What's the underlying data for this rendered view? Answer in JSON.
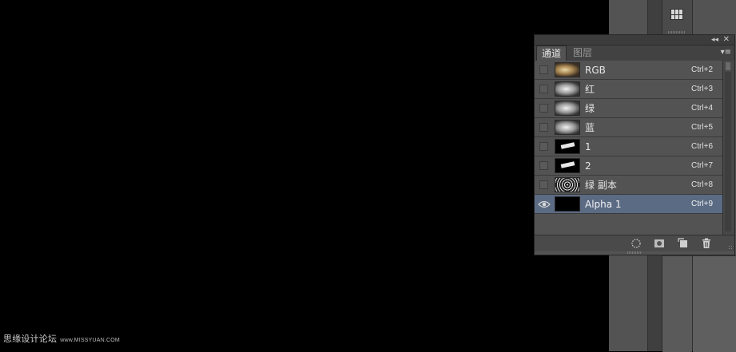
{
  "watermark": {
    "text": "思缘设计论坛",
    "url": "www.MISSYUAN.COM"
  },
  "panel": {
    "tabs": [
      {
        "label": "通道",
        "active": true
      },
      {
        "label": "图层",
        "active": false
      }
    ],
    "channels": [
      {
        "name": "RGB",
        "shortcut": "Ctrl+2",
        "thumb": "rgb",
        "visible": false,
        "selected": false
      },
      {
        "name": "红",
        "shortcut": "Ctrl+3",
        "thumb": "gray",
        "visible": false,
        "selected": false
      },
      {
        "name": "绿",
        "shortcut": "Ctrl+4",
        "thumb": "gray",
        "visible": false,
        "selected": false
      },
      {
        "name": "蓝",
        "shortcut": "Ctrl+5",
        "thumb": "gray",
        "visible": false,
        "selected": false
      },
      {
        "name": "1",
        "shortcut": "Ctrl+6",
        "thumb": "mask",
        "visible": false,
        "selected": false
      },
      {
        "name": "2",
        "shortcut": "Ctrl+7",
        "thumb": "mask",
        "visible": false,
        "selected": false
      },
      {
        "name": "绿 副本",
        "shortcut": "Ctrl+8",
        "thumb": "noise",
        "visible": false,
        "selected": false
      },
      {
        "name": "Alpha 1",
        "shortcut": "Ctrl+9",
        "thumb": "black",
        "visible": true,
        "selected": true
      }
    ],
    "footer_icons": [
      "load-selection-icon",
      "save-selection-icon",
      "new-channel-icon",
      "trash-icon"
    ]
  },
  "colors": {
    "selected_row": "#5b6b84",
    "panel_bg": "#535353",
    "canvas": "#000000"
  }
}
